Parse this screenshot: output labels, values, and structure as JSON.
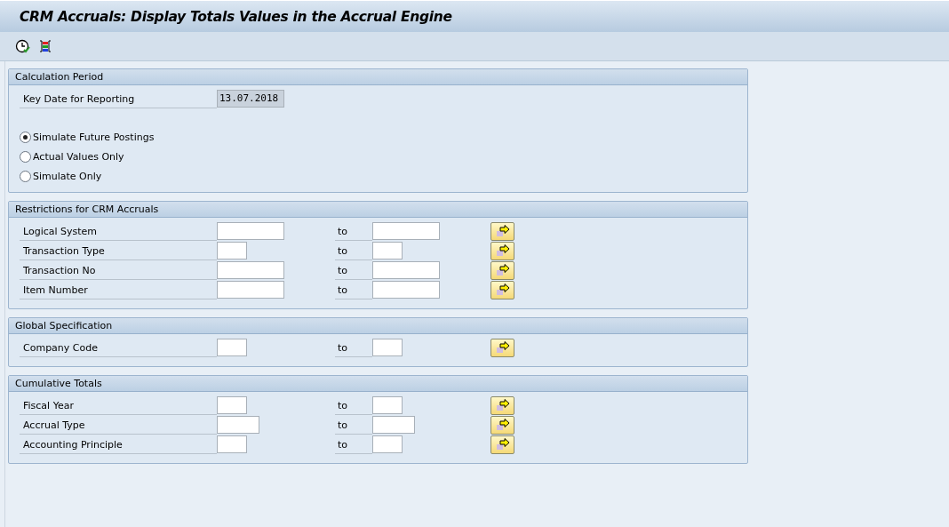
{
  "window": {
    "title": "CRM Accruals: Display Totals Values in the Accrual Engine"
  },
  "sections": [
    {
      "title": "Calculation Period",
      "kind": "period",
      "date_label": "Key Date for Reporting",
      "date_value": "13.07.2018",
      "radios": [
        {
          "label": "Simulate Future Postings",
          "selected": true
        },
        {
          "label": "Actual Values Only",
          "selected": false
        },
        {
          "label": "Simulate Only",
          "selected": false
        }
      ]
    },
    {
      "title": "Restrictions for CRM Accruals",
      "kind": "ranges",
      "rows": [
        {
          "label": "Logical System",
          "to": "to",
          "kind": "long"
        },
        {
          "label": "Transaction Type",
          "to": "to",
          "kind": "short"
        },
        {
          "label": "Transaction No",
          "to": "to",
          "kind": "long"
        },
        {
          "label": "Item Number",
          "to": "to",
          "kind": "long"
        }
      ]
    },
    {
      "title": "Global Specification",
      "kind": "ranges",
      "rows": [
        {
          "label": "Company Code",
          "to": "to",
          "kind": "short"
        }
      ]
    },
    {
      "title": "Cumulative Totals",
      "kind": "ranges",
      "rows": [
        {
          "label": "Fiscal Year",
          "to": "to",
          "kind": "short"
        },
        {
          "label": "Accrual Type",
          "to": "to",
          "kind": "medium"
        },
        {
          "label": "Accounting Principle",
          "to": "to",
          "kind": "short"
        }
      ]
    }
  ]
}
